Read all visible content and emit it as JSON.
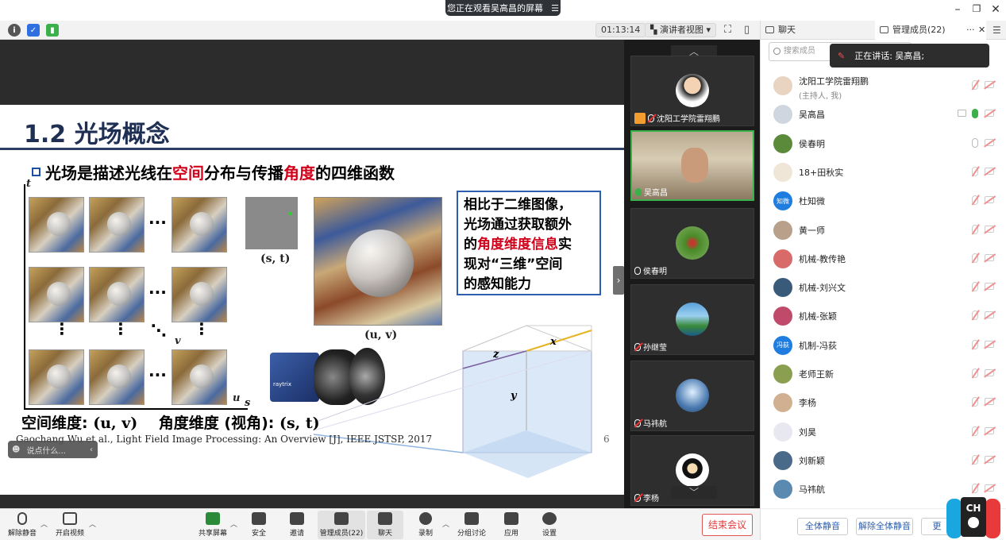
{
  "window": {
    "share_notice": "您正在观看吴高昌的屏幕",
    "share_notice_icon": "menu-icon"
  },
  "toolbar": {
    "timer": "01:13:14",
    "view_mode": "演讲者视图"
  },
  "slide": {
    "title": "1.2 光场概念",
    "bullet_pre": "光场是描述光线在",
    "bullet_red1": "空间",
    "bullet_mid": "分布与传播",
    "bullet_red2": "角度",
    "bullet_post": "的四维函数",
    "axis_t": "t",
    "axis_u": "u",
    "axis_s": "s",
    "axis_v": "v",
    "label_st": "(s, t)",
    "label_uv": "(u, v)",
    "callout_line1": "相比于二维图像，",
    "callout_line2": "光场通过获取额外",
    "callout_line3_pre": "的",
    "callout_line3_red": "角度维度信息",
    "callout_line3_post": "实",
    "callout_line4": "现对“三维”空间",
    "callout_line5": "的感知能力",
    "cube_z": "z",
    "cube_x": "x",
    "cube_y": "y",
    "camera_brand": "raytrix",
    "dims_spatial": "空间维度: ",
    "dims_spatial_val": "(u, v)",
    "dims_angular": "角度维度 (视角): ",
    "dims_angular_val": "(s, t)",
    "citation": "Gaochang Wu et al., Light Field Image Processing: An Overview [J], IEEE JSTSP, 2017",
    "page_number": "6"
  },
  "chat_input": {
    "placeholder": "说点什么..."
  },
  "video_tiles": [
    {
      "name": "沈阳工学院雷翔鹏",
      "muted": true,
      "host": true
    },
    {
      "name": "吴高昌",
      "muted": false,
      "host": false
    },
    {
      "name": "侯春明",
      "muted": false,
      "host": false
    },
    {
      "name": "孙继莹",
      "muted": true,
      "host": false
    },
    {
      "name": "马祎航",
      "muted": true,
      "host": false
    },
    {
      "name": "李杨",
      "muted": true,
      "host": false
    }
  ],
  "panel": {
    "tab_chat": "聊天",
    "tab_members": "管理成员(22)",
    "search_placeholder": "搜索成员",
    "speaking_notice": "正在讲话: 吴高昌;",
    "members": [
      {
        "name": "沈阳工学院雷翔鹏",
        "sub": "(主持人, 我)",
        "mic": "muted",
        "avatar_color": "#e8d4c0"
      },
      {
        "name": "吴高昌",
        "sub": "",
        "mic": "on",
        "avatar_color": "#cfd6df"
      },
      {
        "name": "侯春明",
        "sub": "",
        "mic": "grey",
        "avatar_color": "#5a8a3a"
      },
      {
        "name": "18+田秋实",
        "sub": "",
        "mic": "muted",
        "avatar_color": "#f0e6d8"
      },
      {
        "name": "杜知微",
        "sub": "",
        "mic": "muted",
        "avatar_color": "#1f7de0",
        "avatar_text": "知微"
      },
      {
        "name": "黄一师",
        "sub": "",
        "mic": "muted",
        "avatar_color": "#b8a08a"
      },
      {
        "name": "机械-教传艳",
        "sub": "",
        "mic": "muted",
        "avatar_color": "#d86a6a"
      },
      {
        "name": "机械-刘兴文",
        "sub": "",
        "mic": "muted",
        "avatar_color": "#3a5a7a"
      },
      {
        "name": "机械-张颖",
        "sub": "",
        "mic": "muted",
        "avatar_color": "#c04a6a"
      },
      {
        "name": "机制-冯荻",
        "sub": "",
        "mic": "muted",
        "avatar_color": "#1f7de0",
        "avatar_text": "冯荻"
      },
      {
        "name": "老师王新",
        "sub": "",
        "mic": "muted",
        "avatar_color": "#8aa050"
      },
      {
        "name": "李杨",
        "sub": "",
        "mic": "muted",
        "avatar_color": "#d0b090"
      },
      {
        "name": "刘昊",
        "sub": "",
        "mic": "muted",
        "avatar_color": "#e8e8f0"
      },
      {
        "name": "刘新颖",
        "sub": "",
        "mic": "muted",
        "avatar_color": "#4a6a8a"
      },
      {
        "name": "马祎航",
        "sub": "",
        "mic": "muted",
        "avatar_color": "#5a8ab0"
      }
    ],
    "btn_mute_all": "全体静音",
    "btn_unmute_all": "解除全体静音",
    "btn_more": "更"
  },
  "bottombar": {
    "unmute": "解除静音",
    "start_video": "开启视频",
    "share_screen": "共享屏幕",
    "security": "安全",
    "invite": "邀请",
    "members": "管理成员(22)",
    "chat": "聊天",
    "record": "录制",
    "breakout": "分组讨论",
    "apps": "应用",
    "settings": "设置",
    "end_meeting": "结束会议"
  },
  "colors": {
    "accent_blue": "#2d5fae",
    "danger_red": "#e23b3b",
    "active_green": "#3cb04a",
    "slide_red": "#d0021b"
  }
}
